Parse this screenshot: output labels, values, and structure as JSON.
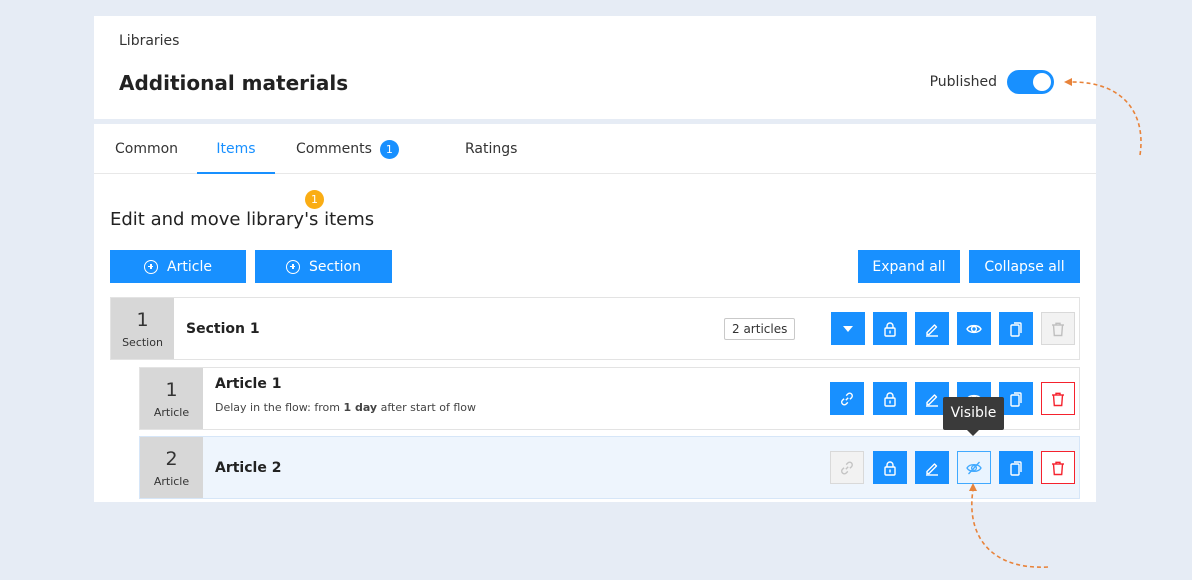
{
  "header": {
    "breadcrumb": "Libraries",
    "title": "Additional materials",
    "published_label": "Published",
    "published": true
  },
  "tabs": [
    {
      "label": "Common",
      "active": false
    },
    {
      "label": "Items",
      "active": true
    },
    {
      "label": "Comments",
      "active": false,
      "badges": [
        "1",
        "1"
      ]
    },
    {
      "label": "Ratings",
      "active": false
    }
  ],
  "items_panel": {
    "heading": "Edit and move library's items",
    "add_article_label": "Article",
    "add_section_label": "Section",
    "expand_all_label": "Expand all",
    "collapse_all_label": "Collapse all"
  },
  "rows": [
    {
      "number": "1",
      "kind": "Section",
      "title": "Section 1",
      "count": "2 articles"
    },
    {
      "number": "1",
      "kind": "Article",
      "title": "Article 1",
      "delay_prefix": "Delay in the flow: from ",
      "delay_value": "1 day",
      "delay_suffix": " after start of flow"
    },
    {
      "number": "2",
      "kind": "Article",
      "title": "Article 2"
    }
  ],
  "tooltip": {
    "text": "Visible"
  },
  "colors": {
    "primary": "#1890ff",
    "danger": "#f5222d",
    "warning": "#faad14",
    "annotation": "#e8833a"
  },
  "icons": [
    "caret-down-icon",
    "link-icon",
    "lock-icon",
    "edit-icon",
    "eye-icon",
    "eye-slash-icon",
    "copy-icon",
    "trash-icon",
    "plus-circle-icon"
  ]
}
